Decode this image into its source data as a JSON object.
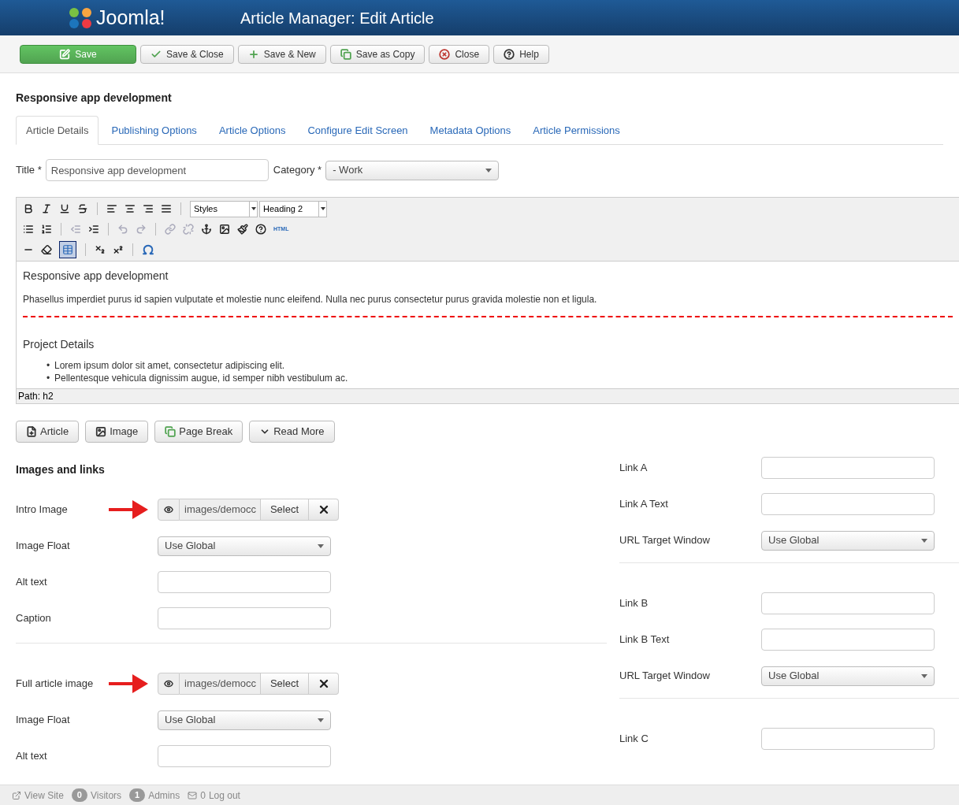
{
  "header": {
    "logo_text": "Joomla!",
    "title": "Article Manager: Edit Article"
  },
  "toolbar": [
    {
      "label": "Save",
      "kind": "save"
    },
    {
      "label": "Save & Close",
      "kind": "check"
    },
    {
      "label": "Save & New",
      "kind": "plus"
    },
    {
      "label": "Save as Copy",
      "kind": "copy"
    },
    {
      "label": "Close",
      "kind": "close"
    },
    {
      "label": "Help",
      "kind": "help"
    }
  ],
  "article_title": "Responsive app development",
  "tabs": [
    {
      "label": "Article Details",
      "selected": true
    },
    {
      "label": "Publishing Options",
      "selected": false
    },
    {
      "label": "Article Options",
      "selected": false
    },
    {
      "label": "Configure Edit Screen",
      "selected": false
    },
    {
      "label": "Metadata Options",
      "selected": false
    },
    {
      "label": "Article Permissions",
      "selected": false
    }
  ],
  "title_field": {
    "label": "Title *",
    "value": "Responsive app development"
  },
  "category_field": {
    "label": "Category *",
    "value": "- Work"
  },
  "editor": {
    "styles_value": "Styles",
    "format_value": "Heading 2",
    "html_label": "HTML",
    "table_tool_selected": true,
    "heading": "Responsive app development",
    "paragraph": "Phasellus imperdiet purus id sapien vulputate et molestie nunc eleifend. Nulla nec purus consectetur purus gravida molestie non et ligula.",
    "section_heading": "Project Details",
    "list_marker": "•",
    "list_items": [
      "Lorem ipsum dolor sit amet, consectetur adipiscing elit.",
      "Pellentesque vehicula dignissim augue, id semper nibh vestibulum ac."
    ],
    "path": "Path: h2"
  },
  "insert_buttons": [
    {
      "label": "Article",
      "kind": "article"
    },
    {
      "label": "Image",
      "kind": "image"
    },
    {
      "label": "Page Break",
      "kind": "copy"
    },
    {
      "label": "Read More",
      "kind": "chevron"
    }
  ],
  "images_section": {
    "title": "Images and links",
    "left_groups": [
      [
        {
          "label": "Intro Image",
          "kind": "media",
          "value": "images/democc",
          "button": "Select"
        },
        {
          "label": "Image Float",
          "kind": "select",
          "value": "Use Global"
        },
        {
          "label": "Alt text",
          "kind": "text"
        },
        {
          "label": "Caption",
          "kind": "text"
        }
      ],
      [
        {
          "label": "Full article image",
          "kind": "media",
          "value": "images/democc",
          "button": "Select"
        },
        {
          "label": "Image Float",
          "kind": "select",
          "value": "Use Global"
        },
        {
          "label": "Alt text",
          "kind": "text"
        }
      ]
    ],
    "right_groups": [
      [
        {
          "label": "Link A",
          "kind": "text"
        },
        {
          "label": "Link A Text",
          "kind": "text"
        },
        {
          "label": "URL Target Window",
          "kind": "select",
          "value": "Use Global"
        }
      ],
      [
        {
          "label": "Link B",
          "kind": "text"
        },
        {
          "label": "Link B Text",
          "kind": "text"
        },
        {
          "label": "URL Target Window",
          "kind": "select",
          "value": "Use Global"
        }
      ],
      [
        {
          "label": "Link C",
          "kind": "text"
        }
      ]
    ]
  },
  "status_bar": {
    "view_site": "View Site",
    "visitors_count": "0",
    "visitors": "Visitors",
    "admins_count": "1",
    "admins": "Admins",
    "messages_count": "0",
    "logout": "Log out"
  }
}
